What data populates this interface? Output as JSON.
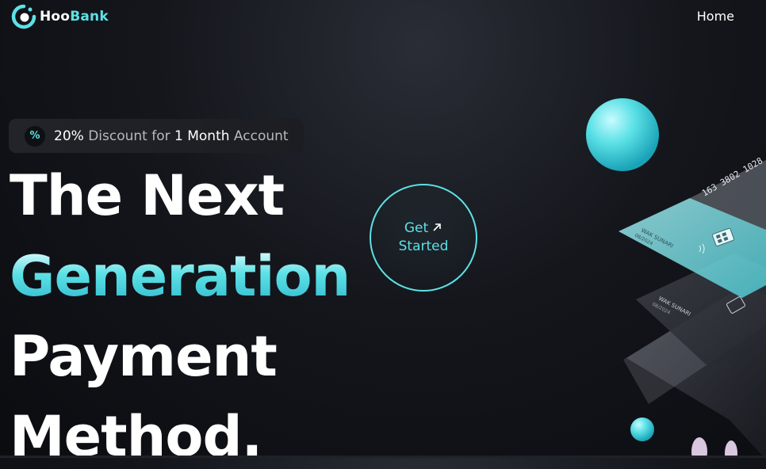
{
  "nav": {
    "logo_prefix": "Hoo",
    "logo_suffix": "Bank",
    "home_label": "Home"
  },
  "badge": {
    "icon_glyph": "%",
    "percent": "20%",
    "discount_text": " Discount for ",
    "duration": "1 Month",
    "account_text": " Account"
  },
  "hero": {
    "line1": "The Next",
    "line2": "Generation",
    "line3": "Payment",
    "line4": "Method."
  },
  "cta": {
    "line1": "Get",
    "line2": "Started"
  },
  "cards": {
    "number_fragment": "163 3802 1028",
    "holder_name": "WAK SUNARI",
    "expiry": "08/2024"
  },
  "colors": {
    "accent": "#5ce1e6",
    "background": "#0b0c10",
    "badge_bg": "#1f2126"
  }
}
